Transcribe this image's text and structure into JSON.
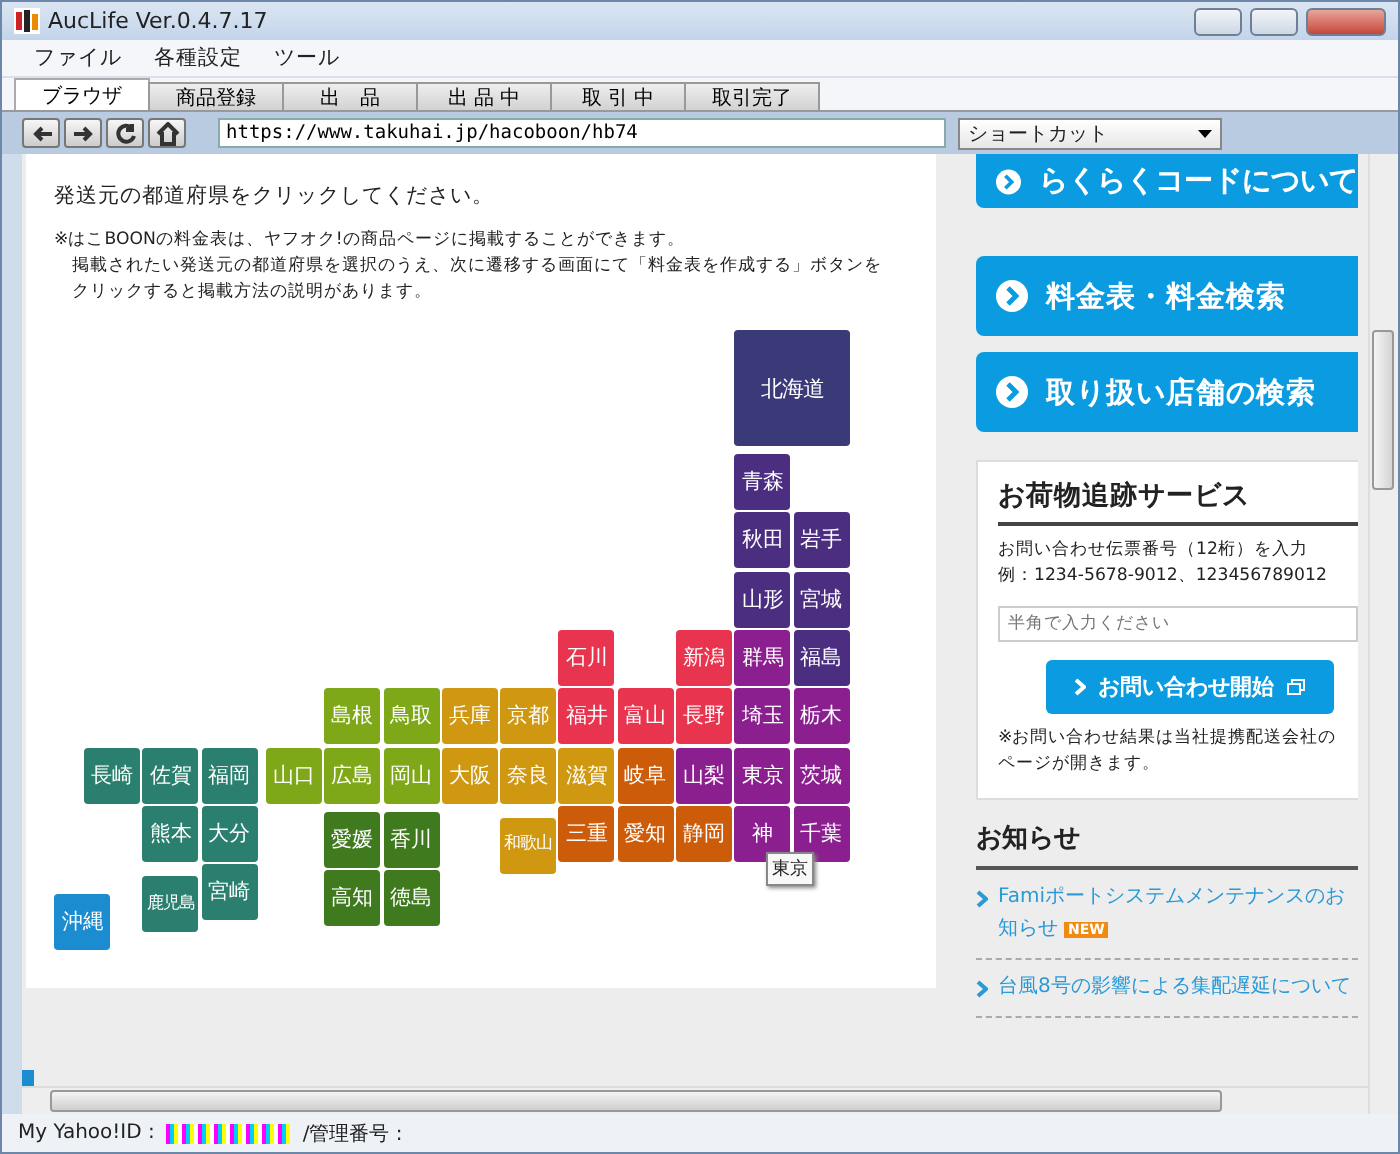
{
  "window": {
    "title": "AucLife Ver.0.4.7.17"
  },
  "menu": [
    "ファイル",
    "各種設定",
    "ツール"
  ],
  "tabs": [
    {
      "label": "ブラウザ",
      "selected": true
    },
    {
      "label": "商品登録",
      "selected": false
    },
    {
      "label": "出　品",
      "selected": false
    },
    {
      "label": "出 品 中",
      "selected": false
    },
    {
      "label": "取 引 中",
      "selected": false
    },
    {
      "label": "取引完了",
      "selected": false
    }
  ],
  "toolbar": {
    "url": "https://www.takuhai.jp/hacoboon/hb74",
    "shortcut": "ショートカット"
  },
  "page": {
    "instruction": "発送元の都道府県をクリックしてください。",
    "notes": [
      "※はこBOONの料金表は、ヤフオク!の商品ページに掲載することができます。",
      "掲載されたい発送元の都道府県を選択のうえ、次に遷移する画面にて「料金表を作成する」ボタンをクリックすると掲載方法の説明があります。"
    ],
    "prefectures": [
      {
        "label": "北海道",
        "color": "#3b3a78"
      },
      {
        "label": "青森",
        "color": "#4b2e80"
      },
      {
        "label": "秋田",
        "color": "#4b2e80"
      },
      {
        "label": "岩手",
        "color": "#4b2e80"
      },
      {
        "label": "山形",
        "color": "#4b2e80"
      },
      {
        "label": "宮城",
        "color": "#4b2e80"
      },
      {
        "label": "石川",
        "color": "#e8344f"
      },
      {
        "label": "新潟",
        "color": "#e8344f"
      },
      {
        "label": "群馬",
        "color": "#8b1f8f"
      },
      {
        "label": "福島",
        "color": "#4b2e80"
      },
      {
        "label": "島根",
        "color": "#7ea818"
      },
      {
        "label": "鳥取",
        "color": "#7ea818"
      },
      {
        "label": "兵庫",
        "color": "#cf9810"
      },
      {
        "label": "京都",
        "color": "#cf9810"
      },
      {
        "label": "福井",
        "color": "#e8344f"
      },
      {
        "label": "富山",
        "color": "#e8344f"
      },
      {
        "label": "長野",
        "color": "#e8344f"
      },
      {
        "label": "埼玉",
        "color": "#8b1f8f"
      },
      {
        "label": "栃木",
        "color": "#8b1f8f"
      },
      {
        "label": "長崎",
        "color": "#2a7f6e"
      },
      {
        "label": "佐賀",
        "color": "#2a7f6e"
      },
      {
        "label": "福岡",
        "color": "#2a7f6e"
      },
      {
        "label": "山口",
        "color": "#7ea818"
      },
      {
        "label": "広島",
        "color": "#7ea818"
      },
      {
        "label": "岡山",
        "color": "#7ea818"
      },
      {
        "label": "大阪",
        "color": "#cf9810"
      },
      {
        "label": "奈良",
        "color": "#cf9810"
      },
      {
        "label": "滋賀",
        "color": "#cf9810"
      },
      {
        "label": "岐阜",
        "color": "#cc5c0a"
      },
      {
        "label": "山梨",
        "color": "#8b1f8f"
      },
      {
        "label": "東京",
        "color": "#8b1f8f"
      },
      {
        "label": "茨城",
        "color": "#8b1f8f"
      },
      {
        "label": "熊本",
        "color": "#2a7f6e"
      },
      {
        "label": "大分",
        "color": "#2a7f6e"
      },
      {
        "label": "愛媛",
        "color": "#3f7a1f"
      },
      {
        "label": "香川",
        "color": "#3f7a1f"
      },
      {
        "label": "和歌山",
        "color": "#cf9810"
      },
      {
        "label": "三重",
        "color": "#cc5c0a"
      },
      {
        "label": "愛知",
        "color": "#cc5c0a"
      },
      {
        "label": "静岡",
        "color": "#cc5c0a"
      },
      {
        "label": "神",
        "color": "#8b1f8f"
      },
      {
        "label": "千葉",
        "color": "#8b1f8f"
      },
      {
        "label": "鹿児島",
        "color": "#2a7f6e"
      },
      {
        "label": "宮崎",
        "color": "#2a7f6e"
      },
      {
        "label": "高知",
        "color": "#3f7a1f"
      },
      {
        "label": "徳島",
        "color": "#3f7a1f"
      },
      {
        "label": "沖縄",
        "color": "#1a8ccf"
      }
    ],
    "tooltip": "東京"
  },
  "sidebar": {
    "links": [
      "らくらくコードについて",
      "料金表・料金検索",
      "取り扱い店舗の検索"
    ],
    "tracking": {
      "title": "お荷物追跡サービス",
      "instruction": "お問い合わせ伝票番号（12桁）を入力",
      "example": "例：1234-5678-9012、123456789012",
      "placeholder": "半角で入力ください",
      "button": "お問い合わせ開始",
      "note": "※お問い合わせ結果は当社提携配送会社のページが開きます。"
    },
    "news": {
      "title": "お知らせ",
      "items": [
        {
          "text": "Famiポートシステムメンテナンスのお知らせ",
          "new": true,
          "badge": "NEW"
        },
        {
          "text": "台風8号の影響による集配遅延について",
          "new": false
        }
      ]
    }
  },
  "status_bar": {
    "id_label": "My Yahoo!ID :",
    "number_label": "/管理番号 :"
  }
}
